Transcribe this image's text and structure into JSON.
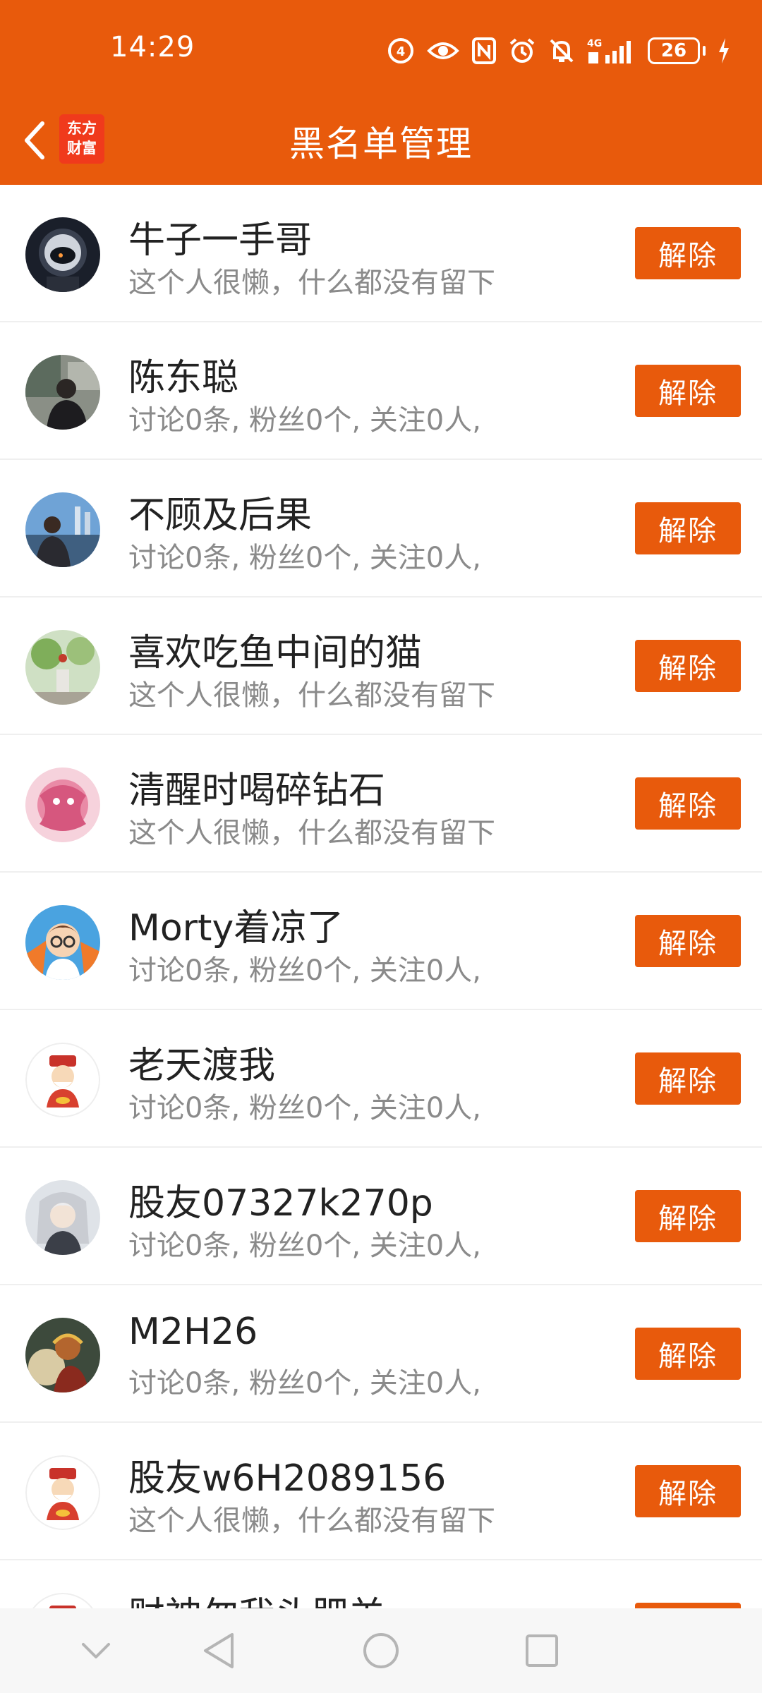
{
  "status_bar": {
    "time": "14:29",
    "battery": "26",
    "network": "4G"
  },
  "header": {
    "title": "黑名单管理",
    "logo_line1": "东方",
    "logo_line2": "财富"
  },
  "colors": {
    "accent": "#E85A0C",
    "logo_red": "#F03A1C",
    "name_text": "#222222",
    "desc_text": "#8A8A8A"
  },
  "blacklist": [
    {
      "name": "牛子一手哥",
      "desc": "这个人很懒，什么都没有留下",
      "button": "解除",
      "avatar": "helmet-avatar"
    },
    {
      "name": "陈东聪",
      "desc": "讨论0条, 粉丝0个, 关注0人,",
      "button": "解除",
      "avatar": "photo-avatar"
    },
    {
      "name": "不顾及后果",
      "desc": "讨论0条, 粉丝0个, 关注0人,",
      "button": "解除",
      "avatar": "photo-avatar"
    },
    {
      "name": "喜欢吃鱼中间的猫",
      "desc": "这个人很懒，什么都没有留下",
      "button": "解除",
      "avatar": "photo-avatar"
    },
    {
      "name": "清醒时喝碎钻石",
      "desc": "这个人很懒，什么都没有留下",
      "button": "解除",
      "avatar": "pink-dragon-avatar"
    },
    {
      "name": "Morty着凉了",
      "desc": "讨论0条, 粉丝0个, 关注0人,",
      "button": "解除",
      "avatar": "cartoon-avatar"
    },
    {
      "name": "老天渡我",
      "desc": "讨论0条, 粉丝0个, 关注0人,",
      "button": "解除",
      "avatar": "fortune-god-avatar"
    },
    {
      "name": "股友07327k270p",
      "desc": "讨论0条, 粉丝0个, 关注0人,",
      "button": "解除",
      "avatar": "anime-avatar"
    },
    {
      "name": "M2H26",
      "desc": "讨论0条, 粉丝0个, 关注0人,",
      "button": "解除",
      "avatar": "monkey-king-avatar"
    },
    {
      "name": "股友w6H2089156",
      "desc": "这个人很懒，什么都没有留下",
      "button": "解除",
      "avatar": "fortune-god-avatar"
    },
    {
      "name": "财神勿我头肥羊",
      "desc": "",
      "button": "解除",
      "avatar": "fortune-god-avatar"
    }
  ]
}
